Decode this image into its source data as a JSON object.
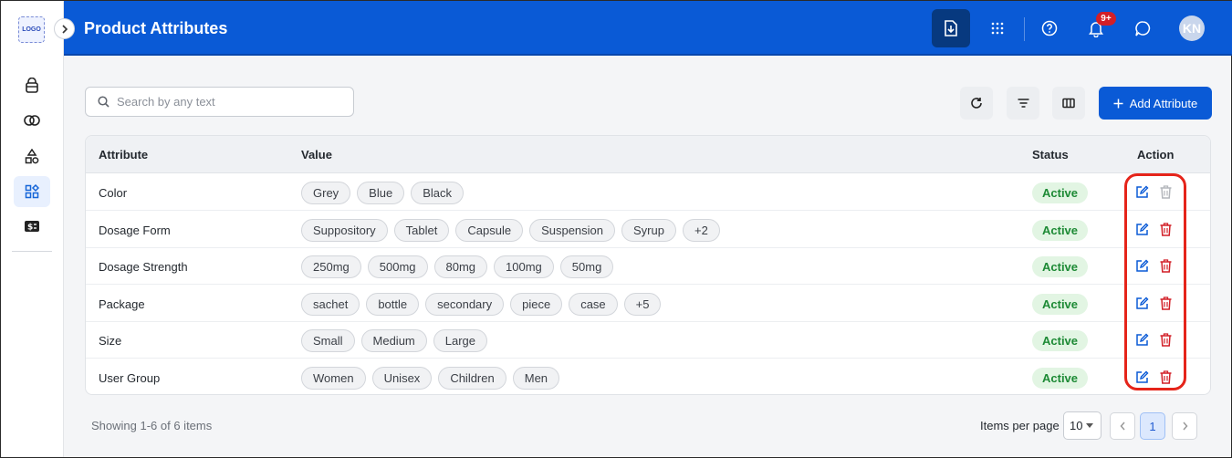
{
  "sidebar": {
    "logo": "LOGO",
    "items": [
      {
        "icon": "bag-icon"
      },
      {
        "icon": "rings-icon"
      },
      {
        "icon": "shapes-icon"
      },
      {
        "icon": "grid-icon",
        "active": true
      },
      {
        "icon": "money-icon"
      }
    ]
  },
  "header": {
    "title": "Product Attributes",
    "notification_count": "9+",
    "avatar_initials": "KN"
  },
  "toolbar": {
    "search_placeholder": "Search by any text",
    "add_label": "Add Attribute"
  },
  "table": {
    "columns": [
      "Attribute",
      "Value",
      "Status",
      "Action"
    ],
    "rows": [
      {
        "attribute": "Color",
        "values": [
          "Grey",
          "Blue",
          "Black"
        ],
        "status": "Active",
        "delete_disabled": true
      },
      {
        "attribute": "Dosage Form",
        "values": [
          "Suppository",
          "Tablet",
          "Capsule",
          "Suspension",
          "Syrup",
          "+2"
        ],
        "status": "Active"
      },
      {
        "attribute": "Dosage Strength",
        "values": [
          "250mg",
          "500mg",
          "80mg",
          "100mg",
          "50mg"
        ],
        "status": "Active"
      },
      {
        "attribute": "Package",
        "values": [
          "sachet",
          "bottle",
          "secondary",
          "piece",
          "case",
          "+5"
        ],
        "status": "Active"
      },
      {
        "attribute": "Size",
        "values": [
          "Small",
          "Medium",
          "Large"
        ],
        "status": "Active"
      },
      {
        "attribute": "User Group",
        "values": [
          "Women",
          "Unisex",
          "Children",
          "Men"
        ],
        "status": "Active"
      }
    ]
  },
  "footer": {
    "showing": "Showing 1-6 of 6 items",
    "items_per_page_label": "Items per page",
    "items_per_page": "10",
    "current_page": "1"
  },
  "colors": {
    "primary": "#0a5ad6",
    "header_dark": "#07397f",
    "status_green": "#1d8a35",
    "delete_red": "#d21f27",
    "highlight_red": "#e5241a"
  }
}
